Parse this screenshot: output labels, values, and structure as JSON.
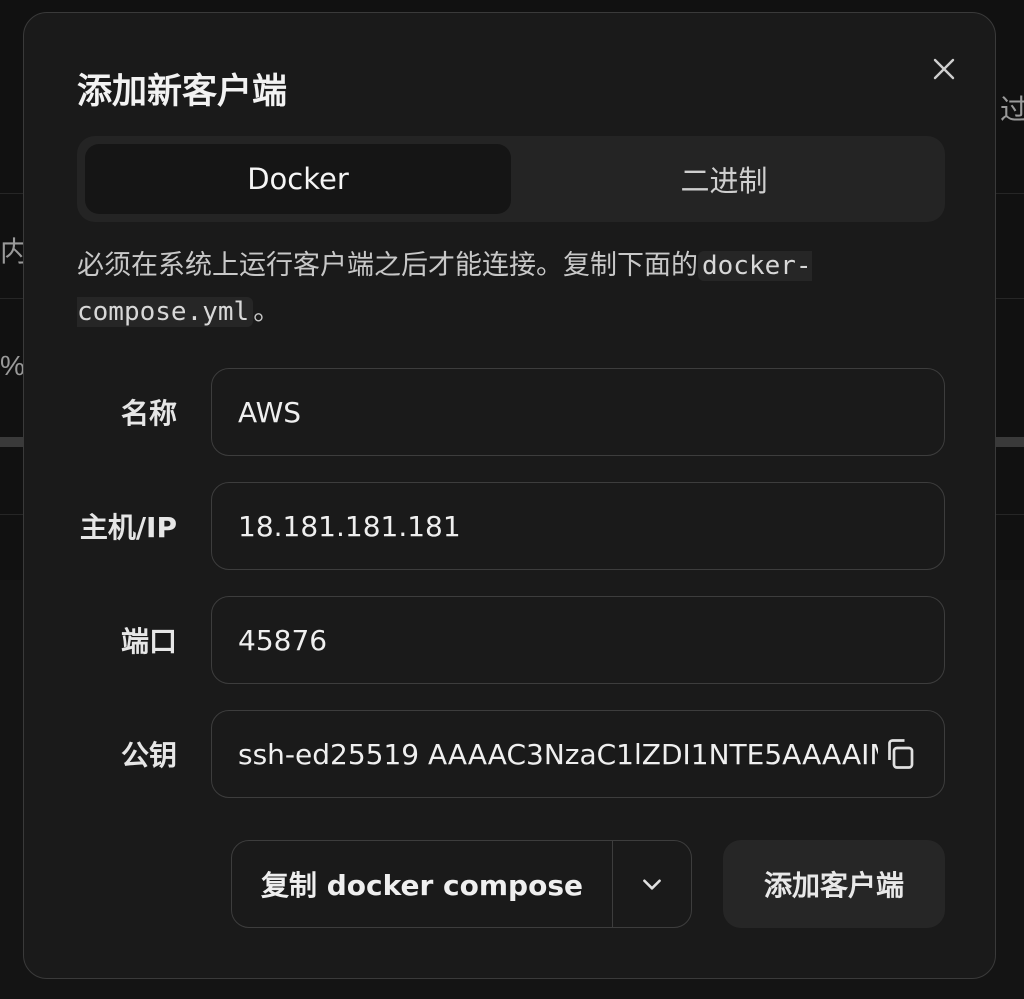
{
  "background": {
    "fragments": [
      "过",
      "内",
      "%"
    ]
  },
  "dialog": {
    "title": "添加新客户端",
    "close_icon": "close-icon",
    "tabs": [
      {
        "label": "Docker",
        "active": true
      },
      {
        "label": "二进制",
        "active": false
      }
    ],
    "description": {
      "text": "必须在系统上运行客户端之后才能连接。复制下面的",
      "code": "docker-compose.yml",
      "suffix": "。"
    },
    "fields": {
      "name": {
        "label": "名称",
        "value": "AWS"
      },
      "host": {
        "label": "主机/IP",
        "value": "18.181.181.181"
      },
      "port": {
        "label": "端口",
        "value": "45876"
      },
      "key": {
        "label": "公钥",
        "value": "ssh-ed25519 AAAAC3NzaC1lZDI1NTE5AAAAIM",
        "icon": "copy-icon"
      }
    },
    "actions": {
      "copy_compose": "复制 docker compose",
      "dropdown_icon": "chevron-down-icon",
      "add_client": "添加客户端"
    }
  },
  "colors": {
    "background": "#141414",
    "dialog": "#1a1a1a",
    "border": "#3a3a3a",
    "tab_active": "#151515"
  }
}
